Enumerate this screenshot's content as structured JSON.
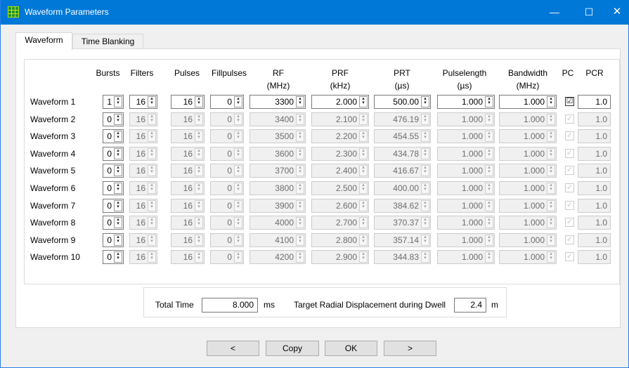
{
  "window": {
    "title": "Waveform Parameters",
    "controls": {
      "minimize": "—",
      "maximize": "☐",
      "close": "✕"
    }
  },
  "tabs": [
    {
      "label": "Waveform",
      "active": true
    },
    {
      "label": "Time Blanking",
      "active": false
    }
  ],
  "headers": {
    "bursts": "Bursts",
    "filters": "Filters",
    "pulses": "Pulses",
    "fillpulses": "Fillpulses",
    "rf": "RF",
    "rf_unit": "(MHz)",
    "prf": "PRF",
    "prf_unit": "(kHz)",
    "prt": "PRT",
    "prt_unit": "(µs)",
    "pulselength": "Pulselength",
    "pulselength_unit": "(µs)",
    "bandwidth": "Bandwidth",
    "bandwidth_unit": "(MHz)",
    "pc": "PC",
    "pcr": "PCR"
  },
  "rows": [
    {
      "label": "Waveform 1",
      "bursts": "1",
      "filters": "16",
      "pulses": "16",
      "fillpulses": "0",
      "rf": "3300",
      "prf": "2.000",
      "prt": "500.00",
      "pulselength": "1.000",
      "bandwidth": "1.000",
      "pc": "☑",
      "pcr": "1.0",
      "enabled": true
    },
    {
      "label": "Waveform 2",
      "bursts": "0",
      "filters": "16",
      "pulses": "16",
      "fillpulses": "0",
      "rf": "3400",
      "prf": "2.100",
      "prt": "476.19",
      "pulselength": "1.000",
      "bandwidth": "1.000",
      "pc": "✓",
      "pcr": "1.0",
      "enabled": false
    },
    {
      "label": "Waveform 3",
      "bursts": "0",
      "filters": "16",
      "pulses": "16",
      "fillpulses": "0",
      "rf": "3500",
      "prf": "2.200",
      "prt": "454.55",
      "pulselength": "1.000",
      "bandwidth": "1.000",
      "pc": "✓",
      "pcr": "1.0",
      "enabled": false
    },
    {
      "label": "Waveform 4",
      "bursts": "0",
      "filters": "16",
      "pulses": "16",
      "fillpulses": "0",
      "rf": "3600",
      "prf": "2.300",
      "prt": "434.78",
      "pulselength": "1.000",
      "bandwidth": "1.000",
      "pc": "✓",
      "pcr": "1.0",
      "enabled": false
    },
    {
      "label": "Waveform 5",
      "bursts": "0",
      "filters": "16",
      "pulses": "16",
      "fillpulses": "0",
      "rf": "3700",
      "prf": "2.400",
      "prt": "416.67",
      "pulselength": "1.000",
      "bandwidth": "1.000",
      "pc": "✓",
      "pcr": "1.0",
      "enabled": false
    },
    {
      "label": "Waveform 6",
      "bursts": "0",
      "filters": "16",
      "pulses": "16",
      "fillpulses": "0",
      "rf": "3800",
      "prf": "2.500",
      "prt": "400.00",
      "pulselength": "1.000",
      "bandwidth": "1.000",
      "pc": "✓",
      "pcr": "1.0",
      "enabled": false
    },
    {
      "label": "Waveform 7",
      "bursts": "0",
      "filters": "16",
      "pulses": "16",
      "fillpulses": "0",
      "rf": "3900",
      "prf": "2.600",
      "prt": "384.62",
      "pulselength": "1.000",
      "bandwidth": "1.000",
      "pc": "✓",
      "pcr": "1.0",
      "enabled": false
    },
    {
      "label": "Waveform 8",
      "bursts": "0",
      "filters": "16",
      "pulses": "16",
      "fillpulses": "0",
      "rf": "4000",
      "prf": "2.700",
      "prt": "370.37",
      "pulselength": "1.000",
      "bandwidth": "1.000",
      "pc": "✓",
      "pcr": "1.0",
      "enabled": false
    },
    {
      "label": "Waveform 9",
      "bursts": "0",
      "filters": "16",
      "pulses": "16",
      "fillpulses": "0",
      "rf": "4100",
      "prf": "2.800",
      "prt": "357.14",
      "pulselength": "1.000",
      "bandwidth": "1.000",
      "pc": "✓",
      "pcr": "1.0",
      "enabled": false
    },
    {
      "label": "Waveform 10",
      "bursts": "0",
      "filters": "16",
      "pulses": "16",
      "fillpulses": "0",
      "rf": "4200",
      "prf": "2.900",
      "prt": "344.83",
      "pulselength": "1.000",
      "bandwidth": "1.000",
      "pc": "✓",
      "pcr": "1.0",
      "enabled": false
    }
  ],
  "footer": {
    "total_time_label": "Total Time",
    "total_time_value": "8.000",
    "total_time_unit": "ms",
    "displacement_label": "Target Radial Displacement during Dwell",
    "displacement_value": "2.4",
    "displacement_unit": "m"
  },
  "buttons": {
    "prev": "<",
    "copy": "Copy",
    "ok": "OK",
    "next": ">"
  },
  "icons": {
    "app": "grid-app-icon",
    "spin_arrows": "⬍"
  },
  "colors": {
    "titlebar": "#0078d7",
    "window_bg": "#f0f0f0",
    "disabled_text": "#6d6d6d"
  }
}
